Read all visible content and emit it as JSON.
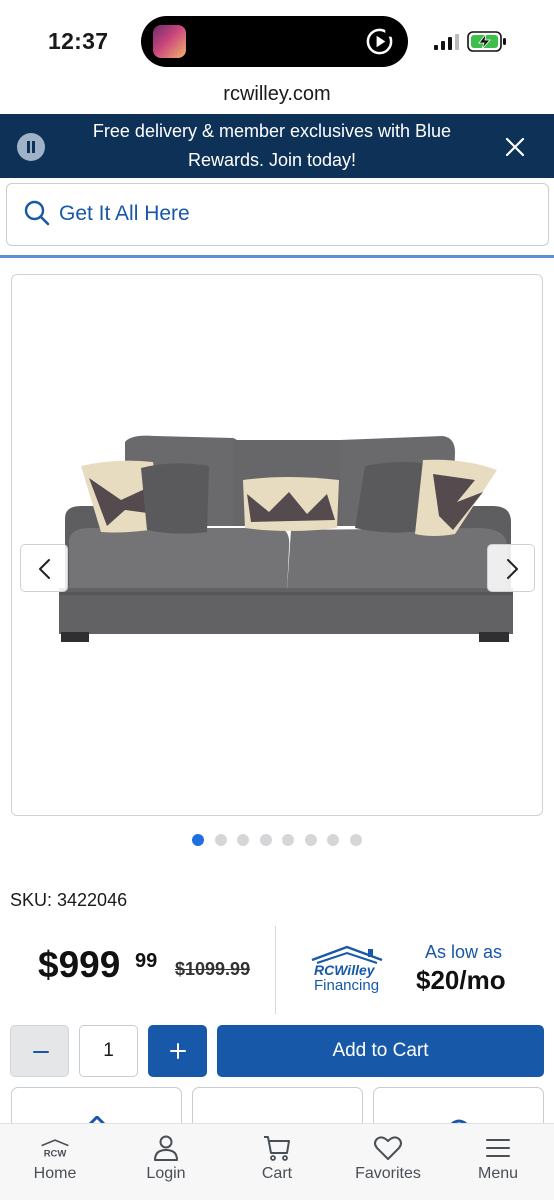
{
  "status_bar": {
    "time": "12:37"
  },
  "browser": {
    "url": "rcwilley.com"
  },
  "promo": {
    "text": "Free delivery & member exclusives with Blue Rewards. Join today!"
  },
  "search": {
    "placeholder": "Get It All Here"
  },
  "gallery": {
    "dot_count": 8,
    "active_dot": 0
  },
  "product": {
    "sku": "SKU: 3422046",
    "price_dollars": "$999",
    "price_cents": "99",
    "price_old": "$1099.99"
  },
  "financing": {
    "brand": "RCWilley",
    "subtitle": "Financing",
    "as_low_as": "As low as",
    "monthly": "$20/mo"
  },
  "cart": {
    "quantity": "1",
    "add_label": "Add to Cart"
  },
  "bottom_nav": {
    "logo_text": "RCW",
    "items": [
      {
        "label": "Home",
        "icon": "rcw-logo-icon"
      },
      {
        "label": "Login",
        "icon": "person-icon"
      },
      {
        "label": "Cart",
        "icon": "cart-icon"
      },
      {
        "label": "Favorites",
        "icon": "heart-icon"
      },
      {
        "label": "Menu",
        "icon": "hamburger-icon"
      }
    ]
  },
  "colors": {
    "brand_blue": "#1858a8",
    "promo_navy": "#0e3257",
    "active_dot": "#1f6fe0"
  }
}
